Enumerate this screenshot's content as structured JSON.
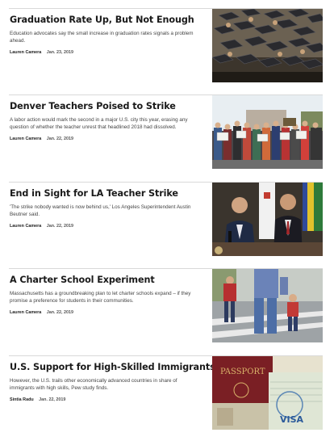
{
  "articles": [
    {
      "headline": "Graduation Rate Up, But Not Enough",
      "summary": "Education advocates say the small increase in graduation rates signals a problem ahead.",
      "author": "Lauren Camera",
      "date": "Jan. 23, 2019",
      "image": "graduation-caps-photo"
    },
    {
      "headline": "Denver Teachers Poised to Strike",
      "summary": "A labor action would mark the second in a major U.S. city this year, erasing any question of whether the teacher unrest that headlined 2018 had dissolved.",
      "author": "Lauren Camera",
      "date": "Jan. 22, 2019",
      "image": "teacher-protest-photo"
    },
    {
      "headline": "End in Sight for LA Teacher Strike",
      "summary": "'The strike nobody wanted is now behind us,' Los Angeles Superintendent Austin Beutner said.",
      "author": "Lauren Camera",
      "date": "Jan. 22, 2019",
      "image": "press-conference-photo"
    },
    {
      "headline": "A Charter School Experiment",
      "summary": "Massachusetts has a groundbreaking plan to let charter schools expand – if they promise a preference for students in their communities.",
      "author": "Lauren Camera",
      "date": "Jan. 22, 2019",
      "image": "family-crosswalk-photo"
    },
    {
      "headline": "U.S. Support for High-Skilled Immigrants",
      "summary": "However, the U.S. trails other economically advanced countries in share of immigrants with high skills, Pew study finds.",
      "author": "Sintia Radu",
      "date": "Jan. 22, 2019",
      "image": "passport-visa-photo",
      "image_text": [
        "PASSPORT",
        "VISA"
      ]
    }
  ]
}
